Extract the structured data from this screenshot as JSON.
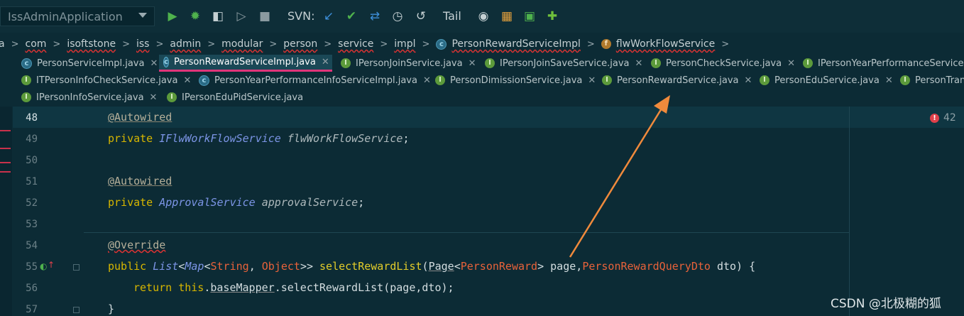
{
  "toolbar": {
    "run_config": "IssAdminApplication",
    "svn_label": "SVN:",
    "tail_label": "Tail"
  },
  "breadcrumb": [
    "a",
    "com",
    "isoftstone",
    "iss",
    "admin",
    "modular",
    "person",
    "service",
    "impl",
    "PersonRewardServiceImpl",
    "flwWorkFlowService"
  ],
  "tabs": {
    "row1": [
      "PersonServiceImpl.java",
      "PersonRewardServiceImpl.java",
      "IPersonJoinService.java",
      "IPersonJoinSaveService.java",
      "PersonCheckService.java",
      "IPersonYearPerformanceService.ja"
    ],
    "row2": [
      "ITPersonInfoCheckService.java",
      "PersonYearPerformanceInfoServiceImpl.java",
      "PersonDimissionService.java",
      "PersonRewardService.java",
      "PersonEduService.java",
      "PersonTran"
    ],
    "row3": [
      "IPersonInfoService.java",
      "IPersonEduPidService.java"
    ]
  },
  "editor": {
    "line_numbers": [
      "48",
      "49",
      "50",
      "51",
      "52",
      "53",
      "54",
      "55",
      "56",
      "57"
    ],
    "error_count": "42",
    "code": {
      "l48": "@Autowired",
      "l49_kw": "private",
      "l49_type": "IFlwWorkFlowService",
      "l49_var": "flwWorkFlowService",
      "l49_end": ";",
      "l51": "@Autowired",
      "l52_kw": "private",
      "l52_type": "ApprovalService",
      "l52_var": "approvalService",
      "l52_end": ";",
      "l54": "@Override",
      "l55_kw": "public",
      "l55_list": "List",
      "l55_lt": "<",
      "l55_map": "Map",
      "l55_lt2": "<",
      "l55_string": "String",
      "l55_comma": ", ",
      "l55_object": "Object",
      "l55_gt": ">> ",
      "l55_method": "selectRewardList",
      "l55_paren": "(",
      "l55_page": "Page",
      "l55_lt3": "<",
      "l55_reward": "PersonReward",
      "l55_gt2": "> page,",
      "l55_dto": "PersonRewardQueryDto",
      "l55_end": " dto) {",
      "l56_kw": "return",
      "l56_this": "this",
      "l56_dot": ".",
      "l56_mapper": "baseMapper",
      "l56_rest": ".selectRewardList(page,dto);",
      "l57": "}"
    }
  },
  "watermark": "CSDN @北极糊的狐",
  "colors": {
    "background": "#0c2b35",
    "active_tab_underline": "#e0357a",
    "arrow": "#f08a3c"
  }
}
